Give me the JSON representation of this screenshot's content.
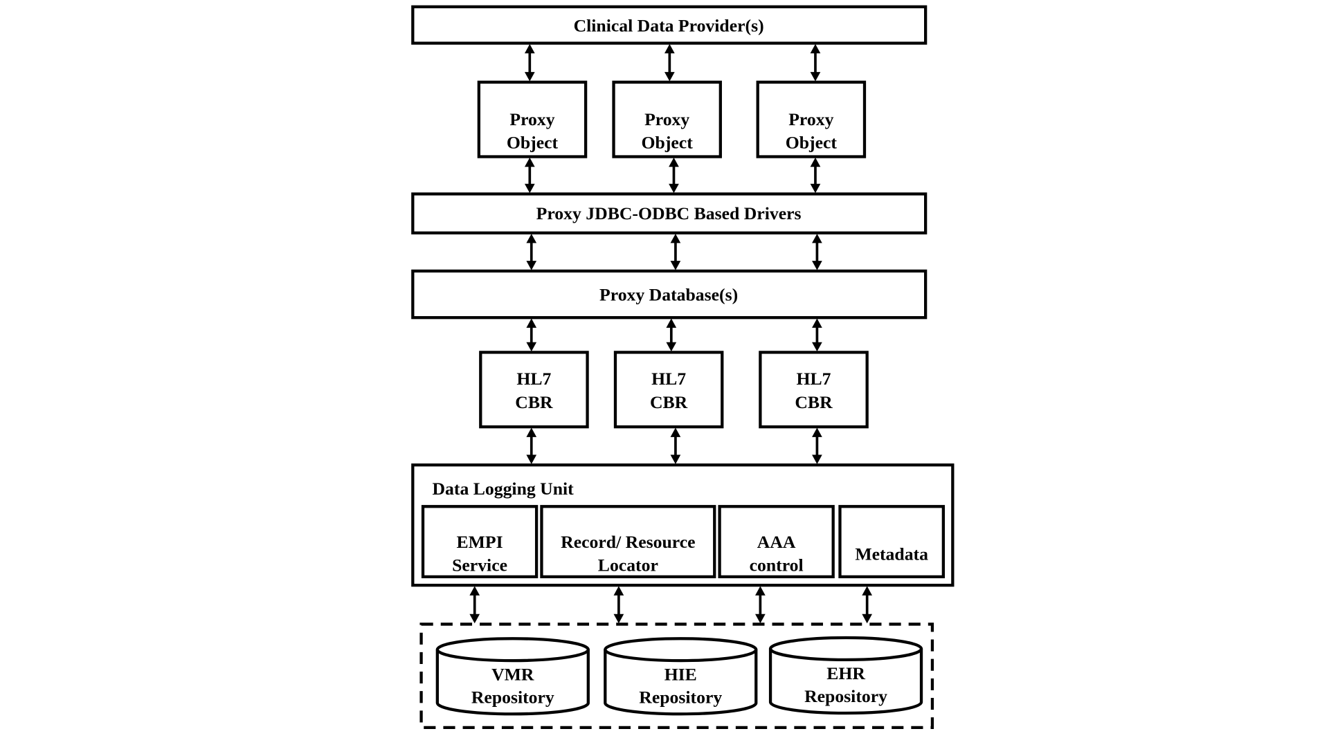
{
  "diagram": {
    "title_layer": "Clinical Data Provider(s)",
    "proxy_objects": [
      {
        "line1": "Proxy",
        "line2": "Object"
      },
      {
        "line1": "Proxy",
        "line2": "Object"
      },
      {
        "line1": "Proxy",
        "line2": "Object"
      }
    ],
    "drivers_layer": "Proxy JDBC-ODBC Based Drivers",
    "database_layer": "Proxy Database(s)",
    "hl7_boxes": [
      {
        "line1": "HL7",
        "line2": "CBR"
      },
      {
        "line1": "HL7",
        "line2": "CBR"
      },
      {
        "line1": "HL7",
        "line2": "CBR"
      }
    ],
    "logging_unit": {
      "title": "Data Logging Unit",
      "components": [
        {
          "line1": "EMPI",
          "line2": "Service"
        },
        {
          "line1": "Record/ Resource",
          "line2": "Locator"
        },
        {
          "line1": "AAA",
          "line2": "control"
        },
        {
          "line1": "Metadata",
          "line2": ""
        }
      ]
    },
    "repositories": [
      {
        "line1": "VMR",
        "line2": "Repository"
      },
      {
        "line1": "HIE",
        "line2": "Repository"
      },
      {
        "line1": "EHR",
        "line2": "Repository"
      }
    ],
    "connectors": [
      {
        "from": "Clinical Data Provider(s)",
        "to": "Proxy Object",
        "count": 3,
        "direction": "bidirectional"
      },
      {
        "from": "Proxy Object",
        "to": "Proxy JDBC-ODBC Based Drivers",
        "count": 3,
        "direction": "bidirectional"
      },
      {
        "from": "Proxy JDBC-ODBC Based Drivers",
        "to": "Proxy Database(s)",
        "count": 3,
        "direction": "bidirectional"
      },
      {
        "from": "Proxy Database(s)",
        "to": "HL7 CBR",
        "count": 3,
        "direction": "bidirectional"
      },
      {
        "from": "HL7 CBR",
        "to": "Data Logging Unit",
        "count": 3,
        "direction": "bidirectional"
      },
      {
        "from": "Data Logging Unit",
        "to": "Repositories",
        "count": 4,
        "direction": "bidirectional"
      }
    ]
  }
}
